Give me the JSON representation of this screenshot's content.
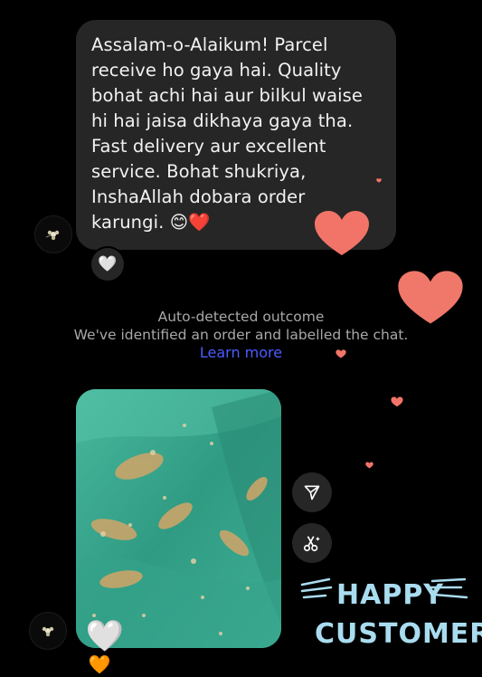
{
  "message": {
    "text": "Assalam-o-Alaikum! Parcel\nreceive ho gaya hai. Quality\nbohat achi hai aur bilkul waise\nhi hai jaisa dikhaya gaya tha.\nFast delivery aur excellent\nservice. Bohat shukriya,\nInshaAllah dobara order\nkarungi.",
    "emoji": "😊❤️",
    "reaction": "🤍"
  },
  "outcome": {
    "title": "Auto-detected outcome",
    "description": "We've identified an order and labelled the chat.",
    "link": "Learn more"
  },
  "photo_reactions": {
    "first": "🤍",
    "second": "🧡"
  },
  "actions": {
    "share_icon": "send-icon",
    "scissors_icon": "cut-sparkle-icon"
  },
  "overlay": {
    "line1": "HAPPY",
    "line2": "CUSTOMER"
  },
  "colors": {
    "background": "#000000",
    "bubble": "#262626",
    "link": "#4b5cff",
    "heart": "#f27468",
    "overlay_text": "#a9dcef",
    "fabric": "#3aa38c"
  }
}
